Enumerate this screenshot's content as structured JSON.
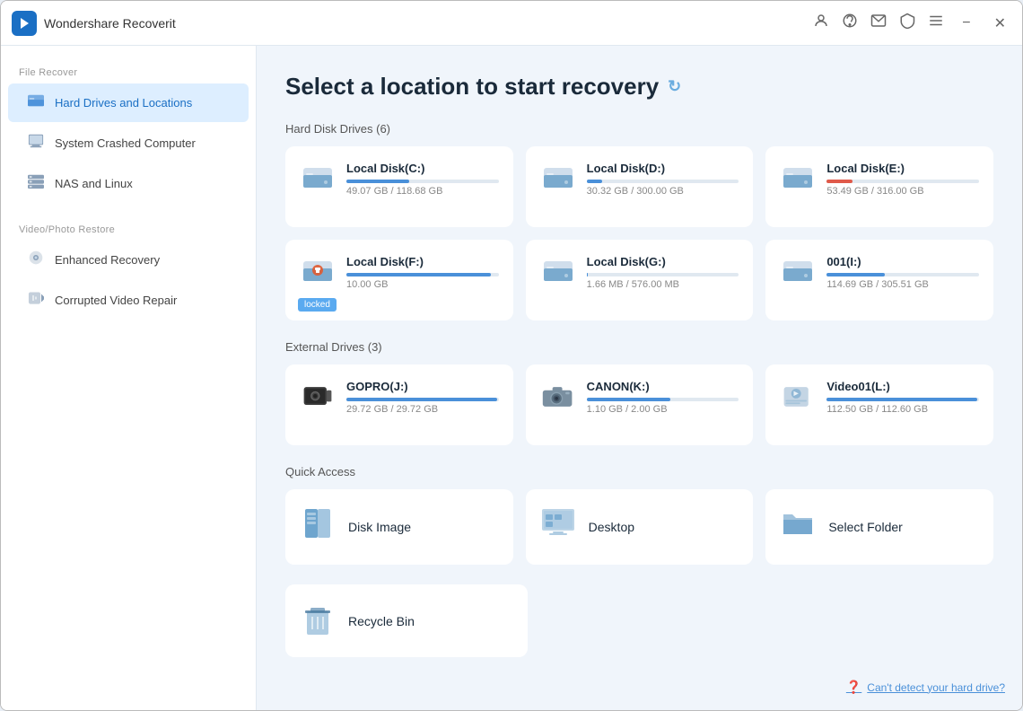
{
  "titleBar": {
    "logoText": "◀",
    "appName": "Wondershare Recoverit",
    "icons": [
      "person",
      "headset",
      "mail",
      "shield",
      "menu",
      "minimize",
      "close"
    ]
  },
  "sidebar": {
    "fileRecoverLabel": "File Recover",
    "items": [
      {
        "id": "hard-drives",
        "label": "Hard Drives and Locations",
        "icon": "💾",
        "active": true
      },
      {
        "id": "system-crashed",
        "label": "System Crashed Computer",
        "icon": "🖥",
        "active": false
      },
      {
        "id": "nas-linux",
        "label": "NAS and Linux",
        "icon": "🗄",
        "active": false
      }
    ],
    "videoPhotoLabel": "Video/Photo Restore",
    "videoItems": [
      {
        "id": "enhanced-recovery",
        "label": "Enhanced Recovery",
        "icon": "📷",
        "active": false
      },
      {
        "id": "corrupted-video",
        "label": "Corrupted Video Repair",
        "icon": "🎬",
        "active": false
      }
    ]
  },
  "content": {
    "pageTitle": "Select a location to start recovery",
    "hardDiskSection": "Hard Disk Drives (6)",
    "externalDrivesSection": "External Drives (3)",
    "quickAccessSection": "Quick Access",
    "hardDisks": [
      {
        "id": "c",
        "name": "Local Disk(C:)",
        "used": 49.07,
        "total": 118.68,
        "pct": 41,
        "locked": false,
        "red": false
      },
      {
        "id": "d",
        "name": "Local Disk(D:)",
        "used": 30.32,
        "total": 300.0,
        "pct": 10,
        "locked": false,
        "red": false
      },
      {
        "id": "e",
        "name": "Local Disk(E:)",
        "used": 53.49,
        "total": 316.0,
        "pct": 17,
        "locked": false,
        "red": true
      },
      {
        "id": "f",
        "name": "Local Disk(F:)",
        "used": 10.0,
        "total": null,
        "pct": 95,
        "locked": true,
        "red": false
      },
      {
        "id": "g",
        "name": "Local Disk(G:)",
        "used": 1.66,
        "total": 576.0,
        "pct": 1,
        "locked": false,
        "red": false
      },
      {
        "id": "i",
        "name": "001(I:)",
        "used": 114.69,
        "total": 305.51,
        "pct": 38,
        "locked": false,
        "red": false
      }
    ],
    "externalDrives": [
      {
        "id": "j",
        "name": "GOPRO(J:)",
        "used": 29.72,
        "total": 29.72,
        "pct": 99,
        "type": "camera-black"
      },
      {
        "id": "k",
        "name": "CANON(K:)",
        "used": 1.1,
        "total": 2.0,
        "pct": 55,
        "type": "camera"
      },
      {
        "id": "l",
        "name": "Video01(L:)",
        "used": 112.5,
        "total": 112.6,
        "pct": 99,
        "type": "person-device"
      }
    ],
    "quickAccess": [
      {
        "id": "disk-image",
        "label": "Disk Image",
        "icon": "book"
      },
      {
        "id": "desktop",
        "label": "Desktop",
        "icon": "desktop"
      },
      {
        "id": "select-folder",
        "label": "Select Folder",
        "icon": "folder"
      }
    ],
    "bottomQuickAccess": [
      {
        "id": "recycle-bin",
        "label": "Recycle Bin",
        "icon": "trash"
      }
    ],
    "cantDetectText": "Can't detect your hard drive?"
  }
}
